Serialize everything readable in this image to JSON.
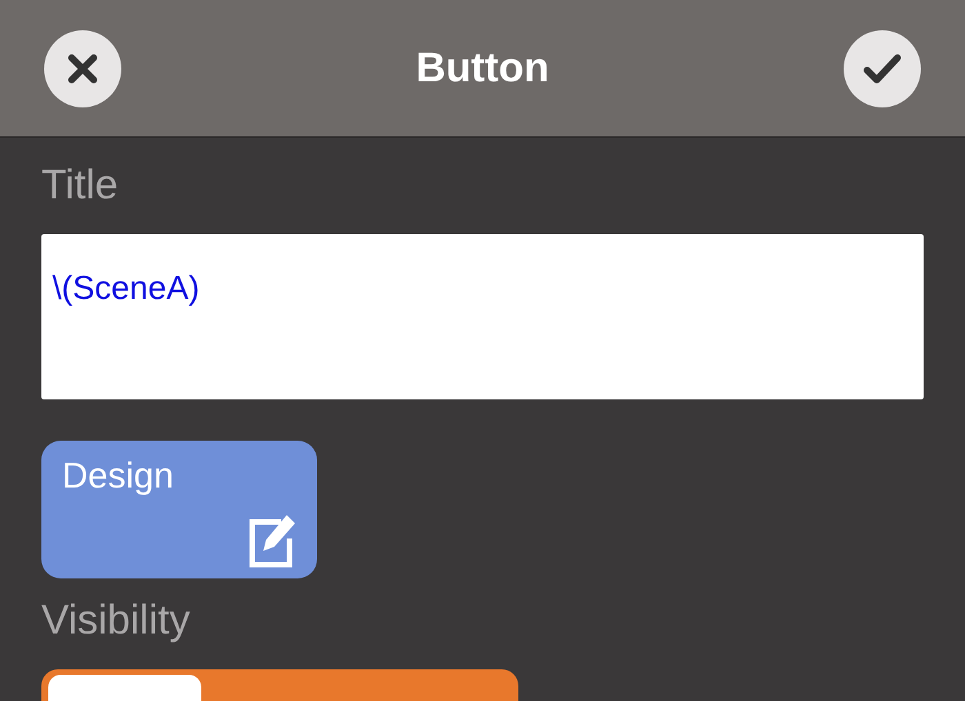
{
  "header": {
    "title": "Button"
  },
  "title_field": {
    "label": "Title",
    "value": "\\(SceneA)"
  },
  "design_button": {
    "label": "Design"
  },
  "visibility": {
    "label": "Visibility",
    "segments": [
      {
        "selected": true
      }
    ]
  }
}
